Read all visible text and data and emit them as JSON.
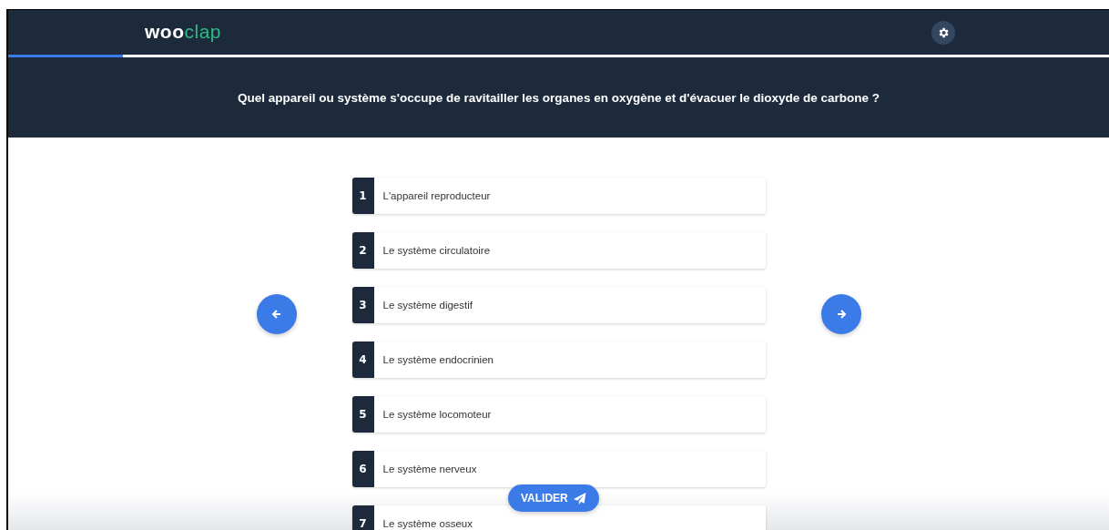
{
  "header": {
    "logo": [
      "woo",
      "clap"
    ],
    "progress": {
      "level": 0.104
    }
  },
  "question": "Quel appareil ou système s'occupe de ravitailler les organes en oxygène et d'évacuer le dioxyde de carbone ?",
  "options": [
    {
      "number": "1",
      "label": "L'appareil reproducteur"
    },
    {
      "number": "2",
      "label": "Le système circulatoire"
    },
    {
      "number": "3",
      "label": "Le système digestif"
    },
    {
      "number": "4",
      "label": "Le système endocrinien"
    },
    {
      "number": "5",
      "label": "Le système locomoteur"
    },
    {
      "number": "6",
      "label": "Le système nerveux"
    },
    {
      "number": "7",
      "label": "Le système osseux"
    }
  ],
  "submit": {
    "label": "VALIDER"
  }
}
